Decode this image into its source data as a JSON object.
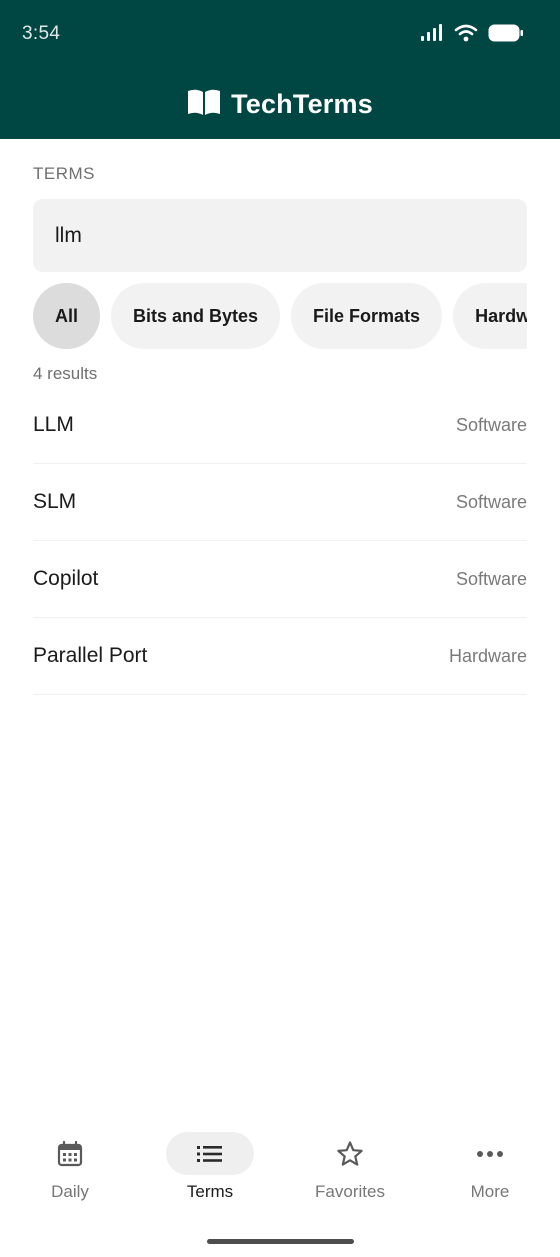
{
  "status_bar": {
    "time": "3:54",
    "icons": [
      "signal-icon",
      "wifi-icon",
      "battery-icon"
    ]
  },
  "header": {
    "logo_icon": "book-icon",
    "title": "TechTerms",
    "background": "#004744"
  },
  "section_label": "TERMS",
  "search": {
    "value": "llm",
    "placeholder": ""
  },
  "chips": [
    {
      "label": "All",
      "selected": true
    },
    {
      "label": "Bits and Bytes",
      "selected": false
    },
    {
      "label": "File Formats",
      "selected": false
    },
    {
      "label": "Hardware",
      "selected": false
    }
  ],
  "results": {
    "count_label": "4 results",
    "items": [
      {
        "term": "LLM",
        "category": "Software"
      },
      {
        "term": "SLM",
        "category": "Software"
      },
      {
        "term": "Copilot",
        "category": "Software"
      },
      {
        "term": "Parallel Port",
        "category": "Hardware"
      }
    ]
  },
  "bottom_nav": {
    "items": [
      {
        "label": "Daily",
        "icon": "calendar-icon",
        "active": false
      },
      {
        "label": "Terms",
        "icon": "list-icon",
        "active": true
      },
      {
        "label": "Favorites",
        "icon": "star-icon",
        "active": false
      },
      {
        "label": "More",
        "icon": "more-icon",
        "active": false
      }
    ]
  }
}
